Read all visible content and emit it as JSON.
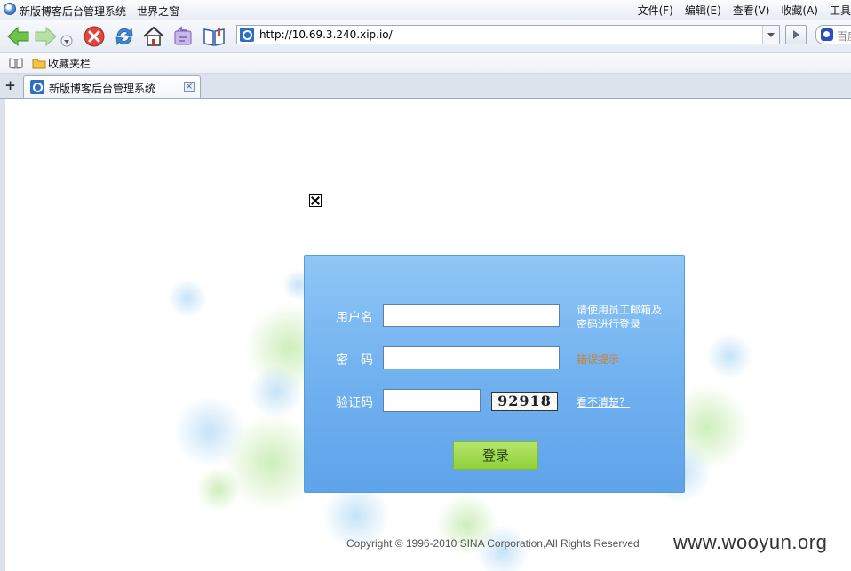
{
  "window": {
    "title": "新版博客后台管理系统 - 世界之窗",
    "menu": [
      "文件(F)",
      "编辑(E)",
      "查看(V)",
      "收藏(A)",
      "工具"
    ]
  },
  "toolbar": {
    "buttons": [
      "back-icon",
      "forward-icon",
      "history-dropdown-icon",
      "stop-icon",
      "refresh-icon",
      "home-icon",
      "restore-icon",
      "favorites-icon"
    ],
    "address": "http://10.69.3.240.xip.io/",
    "search_placeholder": "百度"
  },
  "favorites_bar": {
    "label": "收藏夹栏"
  },
  "tabs": [
    {
      "title": "新版博客后台管理系统",
      "active": true
    }
  ],
  "login": {
    "username_label": "用户名",
    "password_label": "密　码",
    "captcha_label": "验证码",
    "username_value": "",
    "password_value": "",
    "captcha_value": "",
    "captcha_text": "92918",
    "hint": "请使用员工邮箱及密码进行登录",
    "error_hint": "错误提示",
    "refresh_captcha": "看不清楚？",
    "submit": "登录"
  },
  "footer": {
    "copyright": "Copyright © 1996-2010 SINA Corporation,All Rights Reserved",
    "watermark": "www.wooyun.org"
  },
  "colors": {
    "panel": "#6fb0ef",
    "button": "#9bd64a",
    "error": "#d87a20"
  }
}
